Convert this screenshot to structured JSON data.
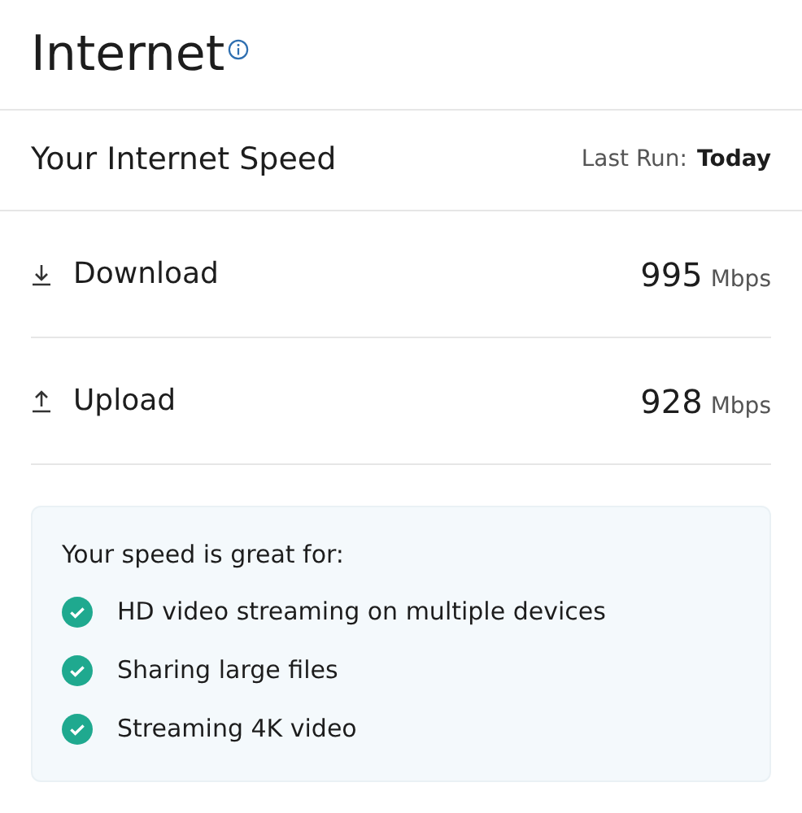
{
  "page": {
    "title": "Internet"
  },
  "speed": {
    "title": "Your Internet Speed",
    "last_run_label": "Last Run:",
    "last_run_value": "Today",
    "rows": [
      {
        "kind": "download",
        "label": "Download",
        "value": "995",
        "unit": "Mbps"
      },
      {
        "kind": "upload",
        "label": "Upload",
        "value": "928",
        "unit": "Mbps"
      }
    ]
  },
  "uses": {
    "heading": "Your speed is great for:",
    "items": [
      {
        "label": "HD video streaming on multiple devices",
        "checked": true
      },
      {
        "label": "Sharing large files",
        "checked": true
      },
      {
        "label": "Streaming 4K video",
        "checked": true
      }
    ]
  }
}
